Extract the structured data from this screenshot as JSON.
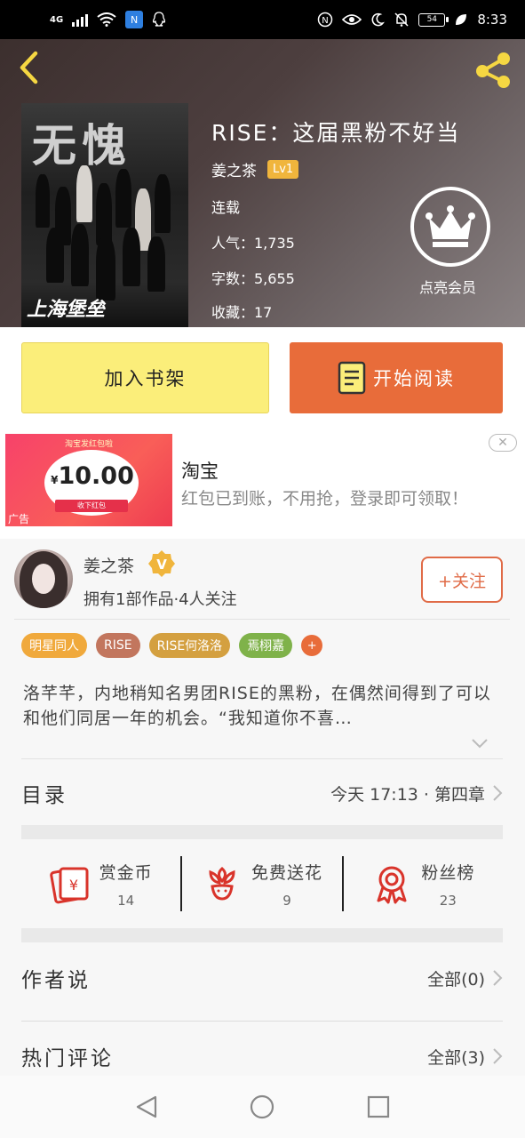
{
  "status_bar": {
    "network": "4G",
    "nfc": "N",
    "battery": "54",
    "time": "8:33"
  },
  "book": {
    "cover_title": "无愧",
    "cover_subtitle": "上海堡垒",
    "title": "RISE：这届黑粉不好当",
    "author": "姜之茶",
    "level": "Lv1",
    "status": "连载",
    "popularity": "人气：1,735",
    "words": "字数：5,655",
    "favorites": "收藏：17",
    "vip_label": "点亮会员"
  },
  "actions": {
    "add_shelf": "加入书架",
    "start_read": "开始阅读"
  },
  "ad": {
    "banner_top": "淘宝发红包啦",
    "amount": "10.00",
    "currency": "¥",
    "receive": "收下红包",
    "tag": "广告",
    "brand": "淘宝",
    "description": "红包已到账，不用抢，登录即可领取！",
    "close": "✕"
  },
  "author_card": {
    "name": "姜之茶",
    "verified": "V",
    "stats": "拥有1部作品·4人关注",
    "follow": "+关注"
  },
  "tags": [
    {
      "label": "明星同人",
      "color": "#f0a93c"
    },
    {
      "label": "RISE",
      "color": "#c2765e"
    },
    {
      "label": "RISE何洛洛",
      "color": "#d4a040"
    },
    {
      "label": "焉栩嘉",
      "color": "#7fb24a"
    },
    {
      "label": "+",
      "color": "#e86c3a"
    }
  ],
  "synopsis": "洛芊芊，内地稍知名男团RISE的黑粉，在偶然间得到了可以和他们同居一年的机会。“我知道你不喜…",
  "toc": {
    "title": "目录",
    "latest": "今天 17:13 · 第四章"
  },
  "rewards": [
    {
      "label": "赏金币",
      "value": "14",
      "icon": "red-envelope-icon"
    },
    {
      "label": "免费送花",
      "value": "9",
      "icon": "flower-icon"
    },
    {
      "label": "粉丝榜",
      "value": "23",
      "icon": "medal-icon"
    }
  ],
  "author_say": {
    "title": "作者说",
    "all": "全部(0)"
  },
  "hot_comments": {
    "title": "热门评论",
    "all": "全部(3)"
  },
  "colors": {
    "accent_orange": "#e86c3a",
    "shelf_yellow": "#fbee7a",
    "level_gold": "#f0b53c",
    "share_yellow": "#f5d742"
  }
}
